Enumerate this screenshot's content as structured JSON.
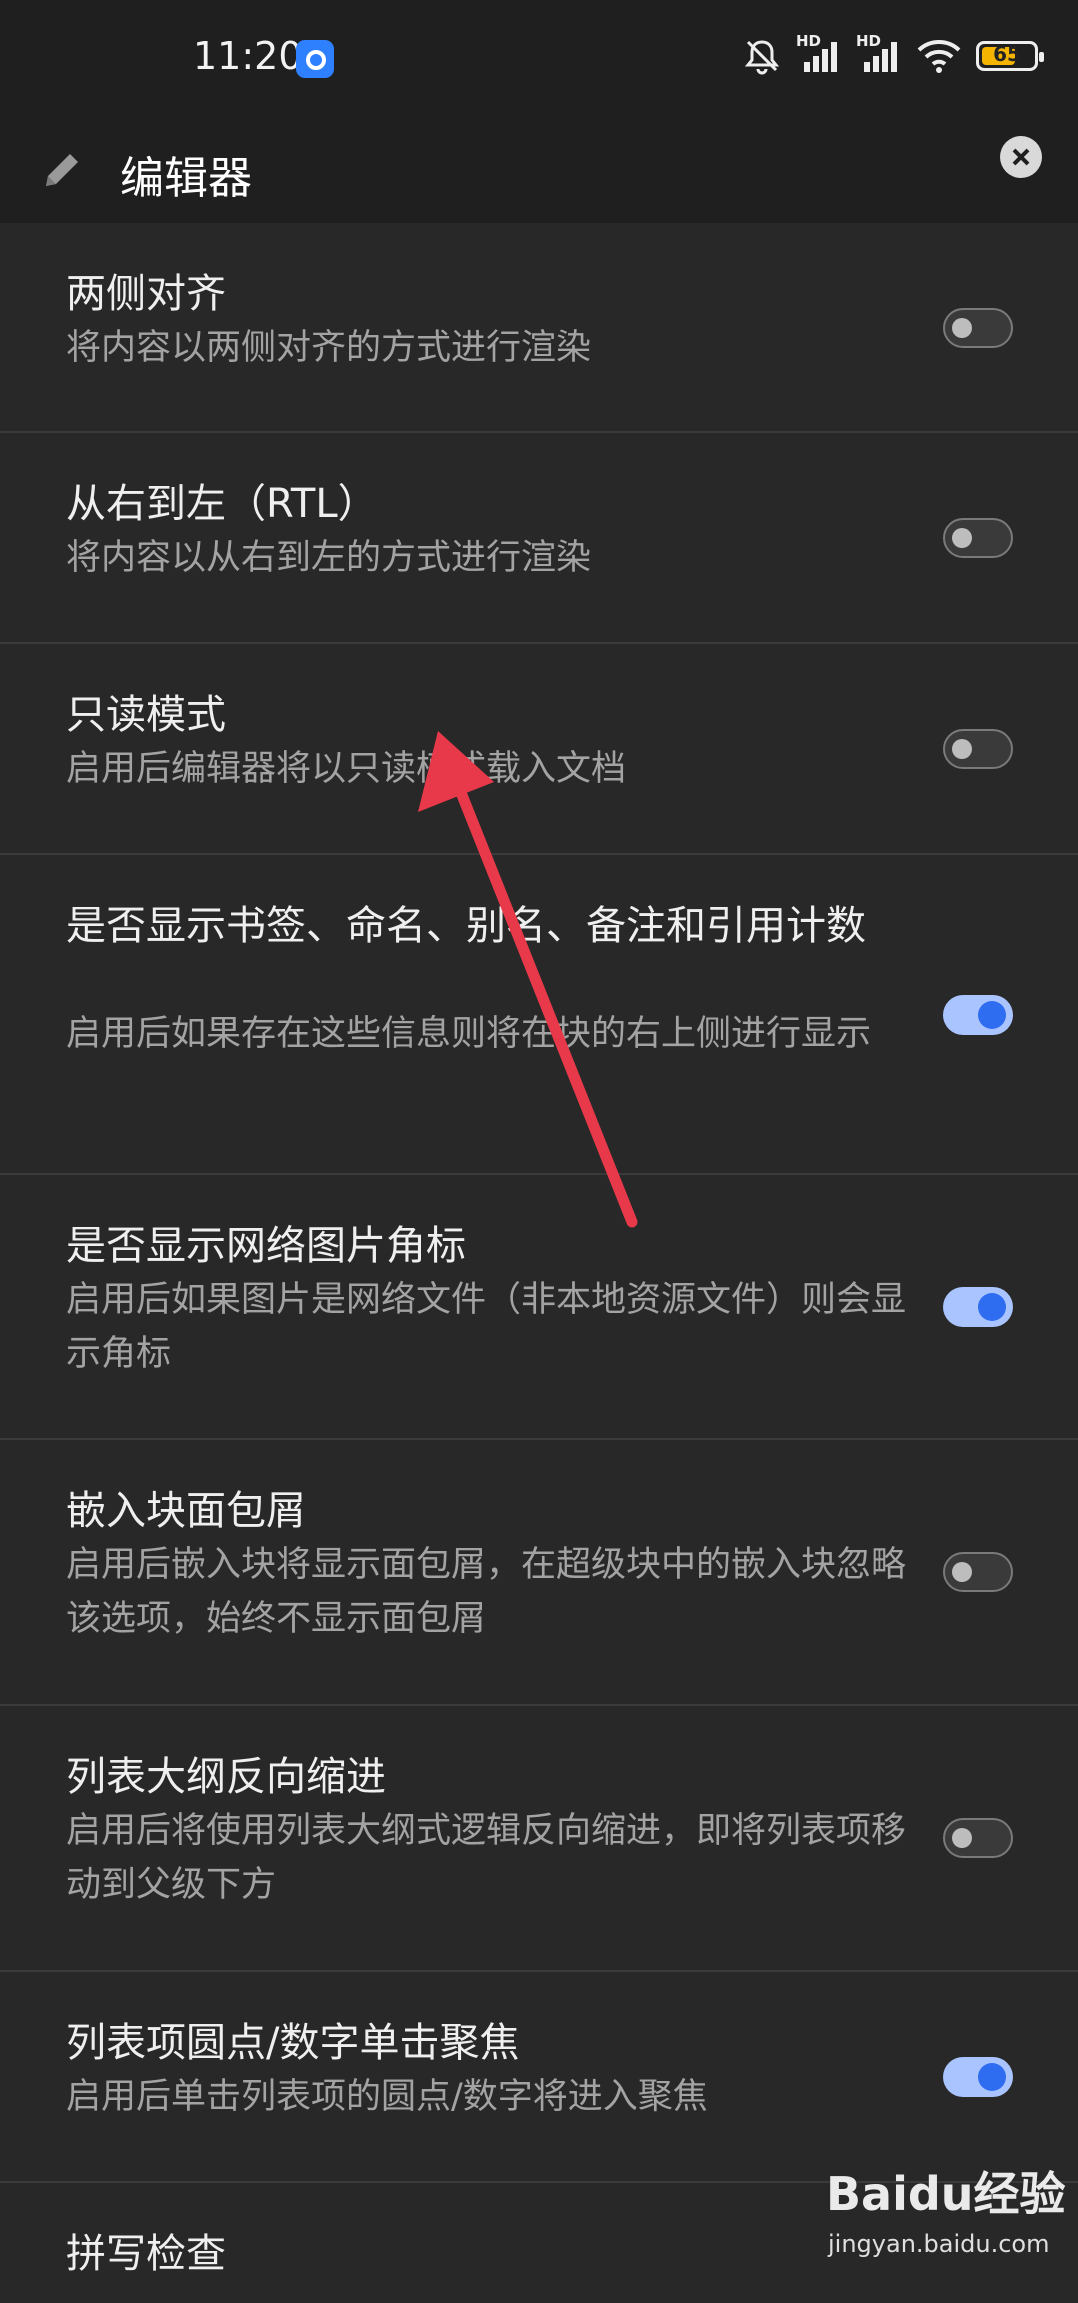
{
  "status_bar": {
    "time": "11:20",
    "signal1": "HD",
    "signal2": "HD",
    "battery_level": "65",
    "battery_color": "#f4b400"
  },
  "header": {
    "title": "编辑器",
    "edit_icon": "pencil-icon",
    "close_icon": "close-icon"
  },
  "settings": [
    {
      "title": "两侧对齐",
      "desc": "将内容以两侧对齐的方式进行渲染",
      "enabled": false
    },
    {
      "title": "从右到左（RTL）",
      "desc": "将内容以从右到左的方式进行渲染",
      "enabled": false
    },
    {
      "title": "只读模式",
      "desc": "启用后编辑器将以只读模式载入文档",
      "enabled": false
    },
    {
      "title": "是否显示书签、命名、别名、备注和引用计数",
      "desc": "启用后如果存在这些信息则将在块的右上侧进行显示",
      "enabled": true
    },
    {
      "title": "是否显示网络图片角标",
      "desc": "启用后如果图片是网络文件（非本地资源文件）则会显示角标",
      "enabled": true
    },
    {
      "title": "嵌入块面包屑",
      "desc": "启用后嵌入块将显示面包屑，在超级块中的嵌入块忽略该选项，始终不显示面包屑",
      "enabled": false
    },
    {
      "title": "列表大纲反向缩进",
      "desc": "启用后将使用列表大纲式逻辑反向缩进，即将列表项移动到父级下方",
      "enabled": false
    },
    {
      "title": "列表项圆点/数字单击聚焦",
      "desc": "启用后单击列表项的圆点/数字将进入聚焦",
      "enabled": true
    },
    {
      "title": "拼写检查",
      "desc": "",
      "enabled": false
    }
  ],
  "watermark": {
    "brand": "Baidu经验",
    "url": "jingyan.baidu.com"
  },
  "colors": {
    "accent": "#2e6cf0",
    "annotation_arrow": "#e8394a"
  }
}
